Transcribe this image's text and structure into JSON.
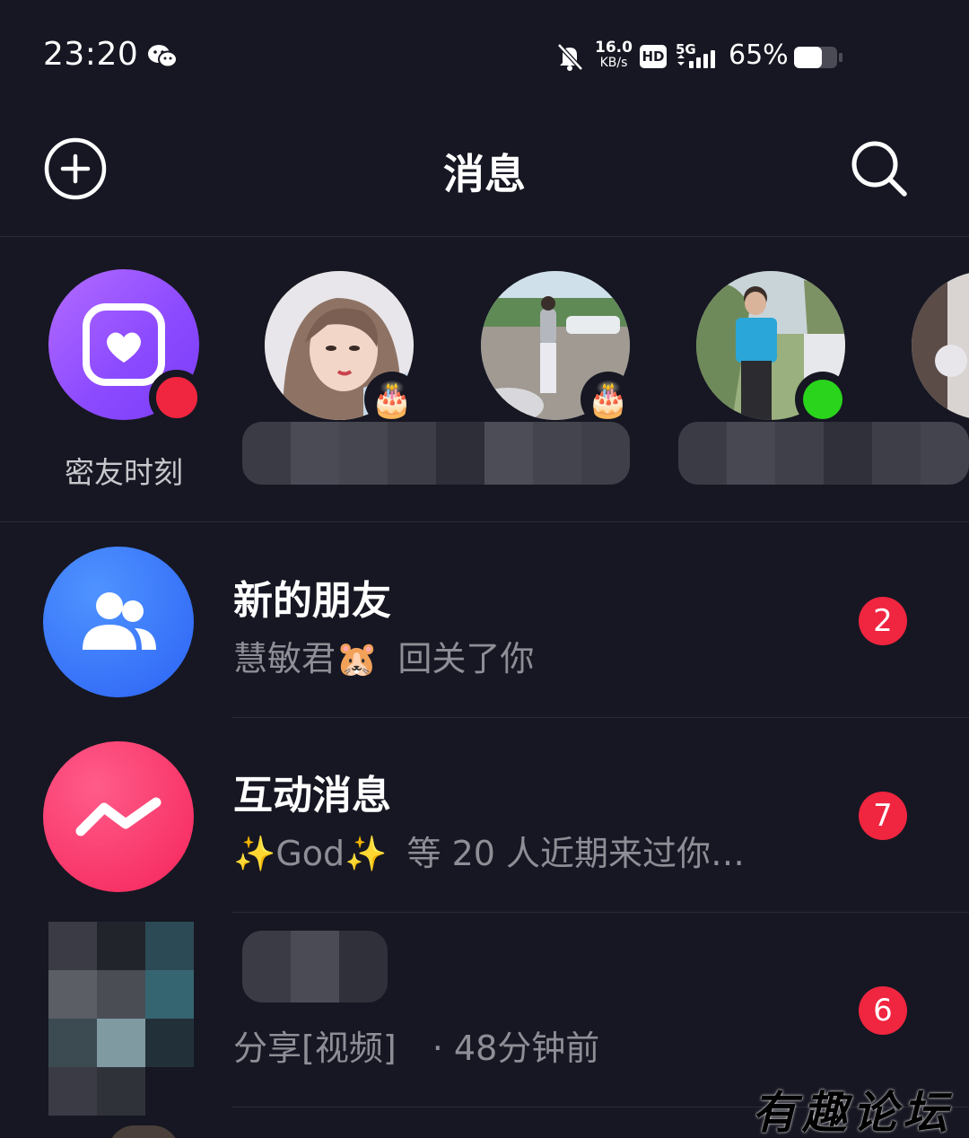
{
  "status_bar": {
    "time": "23:20",
    "net_speed_value": "16.0",
    "net_speed_unit": "KB/s",
    "hd_label": "HD",
    "network_label": "5G",
    "battery_percent": "65%",
    "battery_level": 0.65,
    "icons": [
      "wechat-icon",
      "bell-muted-icon",
      "signal-icon",
      "battery-icon"
    ]
  },
  "header": {
    "title": "消息",
    "add_icon": "plus-circle-icon",
    "search_icon": "search-icon"
  },
  "stories": {
    "moment_label": "密友时刻",
    "moment_icon": "heart-square-icon",
    "items": [
      {
        "badge": "🎂",
        "kind": "birthday"
      },
      {
        "badge": "🎂",
        "kind": "birthday"
      },
      {
        "badge": "",
        "kind": "online"
      },
      {
        "badge": "",
        "kind": "partial"
      }
    ]
  },
  "conversations": [
    {
      "title": "新的朋友",
      "subtitle_name": "慧敏君🐹",
      "subtitle_text": "回关了你",
      "badge": "2",
      "icon": "people-icon",
      "color": "#3d7bff"
    },
    {
      "title": "互动消息",
      "subtitle_name": "✨God✨",
      "subtitle_text": "等 20 人近期来过你…",
      "badge": "7",
      "icon": "zigzag-icon",
      "color": "#ff2d6e"
    },
    {
      "title": "",
      "subtitle_name": "分享[视频]",
      "subtitle_text": "· 48分钟前",
      "badge": "6",
      "icon": "",
      "color": ""
    }
  ],
  "watermark": "有趣论坛"
}
